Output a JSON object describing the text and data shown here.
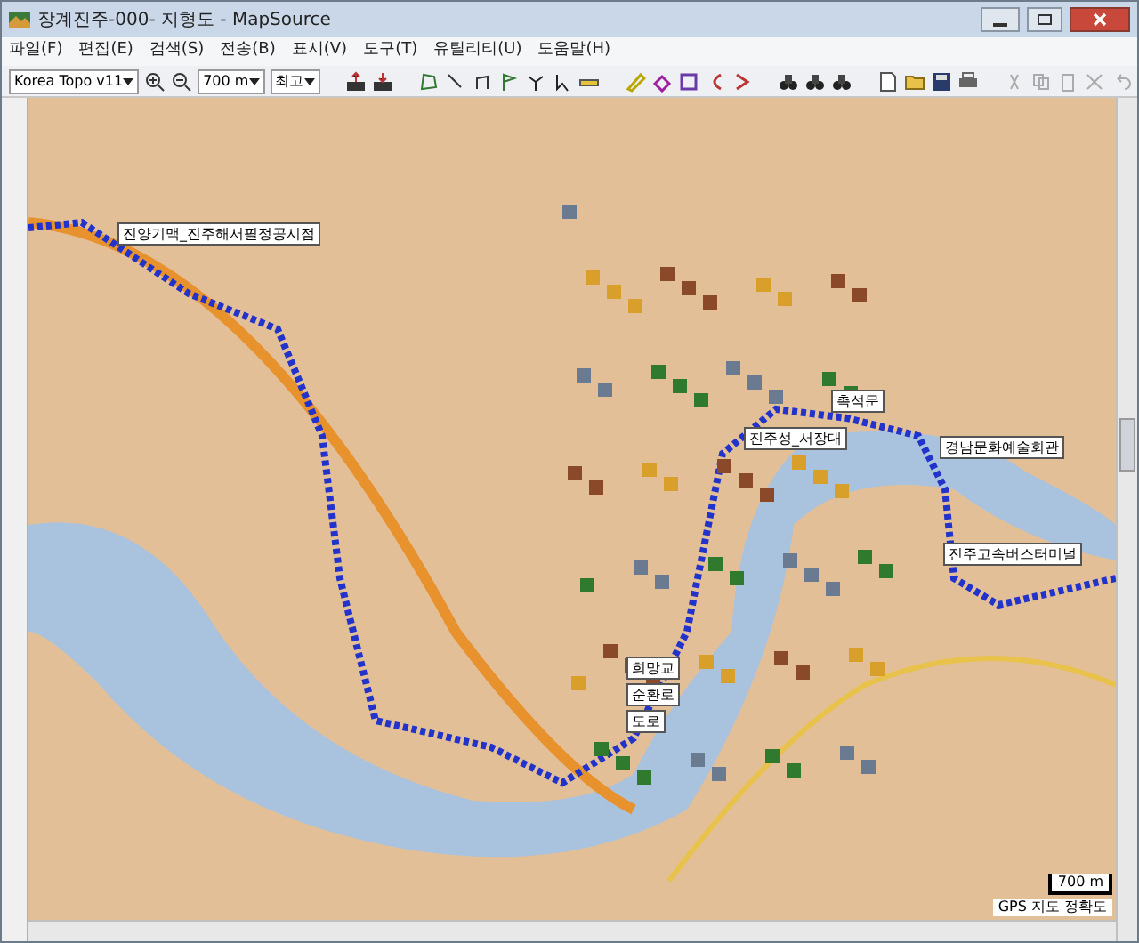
{
  "window": {
    "title": "장계진주-000- 지형도 - MapSource"
  },
  "menu": [
    "파일(F)",
    "편집(E)",
    "검색(S)",
    "전송(B)",
    "표시(V)",
    "도구(T)",
    "유틸리티(U)",
    "도움말(H)"
  ],
  "toolbar": {
    "map_product": "Korea Topo v11",
    "zoom_scale": "700 m",
    "detail": "최고"
  },
  "waypoints": [
    {
      "label": "진양기맥_진주해서필정공시점"
    },
    {
      "label": "촉석문"
    },
    {
      "label": "진주성_서장대"
    },
    {
      "label": "경남문화예술회관"
    },
    {
      "label": "진주고속버스터미널"
    },
    {
      "label": "희망교"
    },
    {
      "label": "순환로"
    },
    {
      "label": "도로"
    }
  ],
  "scale_bar": "700 m",
  "gps_accuracy": "GPS 지도 정확도"
}
